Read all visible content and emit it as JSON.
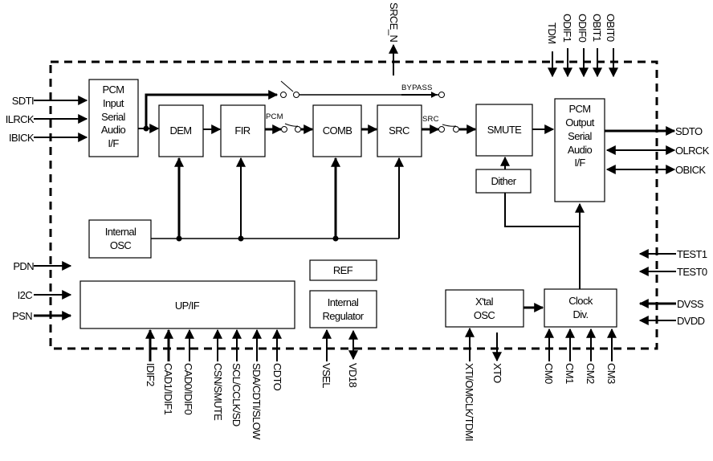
{
  "diagram": {
    "type": "block-diagram",
    "blocks": {
      "pcm_input": [
        "PCM",
        "Input",
        "Serial",
        "Audio",
        "I/F"
      ],
      "dem": "DEM",
      "fir": "FIR",
      "comb": "COMB",
      "src": "SRC",
      "smute": "SMUTE",
      "dither": "Dither",
      "pcm_output": [
        "PCM",
        "Output",
        "Serial",
        "Audio",
        "I/F"
      ],
      "internal_osc": [
        "Internal",
        "OSC"
      ],
      "upif": "UP/IF",
      "ref": "REF",
      "internal_regulator": [
        "Internal",
        "Regulator"
      ],
      "xtal_osc": [
        "X'tal",
        "OSC"
      ],
      "clock_div": [
        "Clock",
        "Div."
      ]
    },
    "switch_labels": {
      "bypass": "BYPASS",
      "pcm": "PCM",
      "src": "SRC"
    },
    "pins": {
      "left_inputs": [
        "SDTI",
        "ILRCK",
        "IBICK"
      ],
      "left_control": [
        "PDN",
        "I2C",
        "PSN"
      ],
      "top": {
        "srce": "SRCE_N",
        "output_format": [
          "TDM",
          "ODIF1",
          "ODIF0",
          "OBIT1",
          "OBIT0"
        ]
      },
      "right_outputs": [
        "SDTO",
        "OLRCK",
        "OBICK"
      ],
      "right_test": [
        "TEST1",
        "TEST0"
      ],
      "right_power": [
        "DVSS",
        "DVDD"
      ],
      "bottom_upif": [
        "IDIF2",
        "CAD1/IDIF1",
        "CAD0/IDIF0",
        "CSN/SMUTE",
        "SCL/CCLK/SD",
        "SDA/CDTI/SLOW",
        "CDTO"
      ],
      "bottom_regulator": [
        "VSEL",
        "VD18"
      ],
      "bottom_clock": [
        "XTI/OMCLK/TDMI",
        "XTO"
      ],
      "bottom_cm": [
        "CM0",
        "CM1",
        "CM2",
        "CM3"
      ]
    }
  }
}
